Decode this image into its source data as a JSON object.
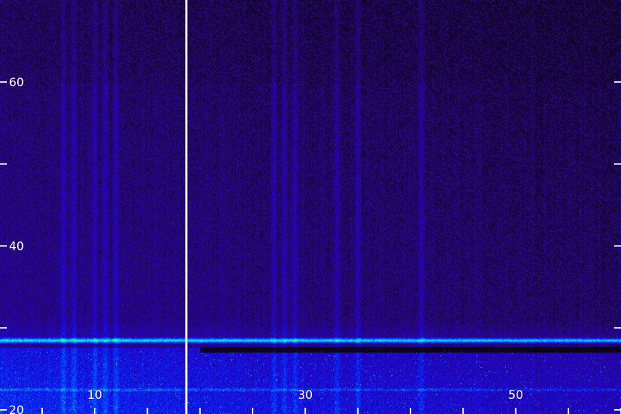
{
  "chart_data": {
    "type": "heatmap",
    "title": "",
    "xlabel": "",
    "ylabel": "",
    "xlim": [
      1,
      60
    ],
    "ylim": [
      19.5,
      70
    ],
    "x_tick_labels": [
      {
        "value": 10,
        "text": "10"
      },
      {
        "value": 30,
        "text": "30"
      },
      {
        "value": 50,
        "text": "50"
      }
    ],
    "x_minor_ticks": [
      5,
      10,
      15,
      20,
      25,
      30,
      35,
      40,
      45,
      50,
      55,
      60
    ],
    "y_tick_labels": [
      {
        "value": 20,
        "text": "20"
      },
      {
        "value": 40,
        "text": "40"
      },
      {
        "value": 60,
        "text": "60"
      }
    ],
    "y_minor_ticks": [
      20,
      30,
      40,
      50,
      60
    ],
    "marker_line_x": 18.7,
    "grid": false,
    "colormap": [
      "#000000",
      "#2a0a6e",
      "#2200cc",
      "#0033ff",
      "#0099ff",
      "#00ffcc",
      "#66ff33"
    ],
    "bands": [
      {
        "y": 28.5,
        "intensity": "high",
        "note": "bright green-cyan horizontal band"
      },
      {
        "y": 27.4,
        "intensity": "null",
        "note": "dark gap below band, x > 20"
      },
      {
        "y": 22.5,
        "intensity": "medium",
        "note": "faint green line"
      }
    ],
    "vertical_streaks_x": [
      7,
      8,
      10,
      11,
      12,
      27,
      28,
      29,
      33,
      35,
      41
    ]
  }
}
